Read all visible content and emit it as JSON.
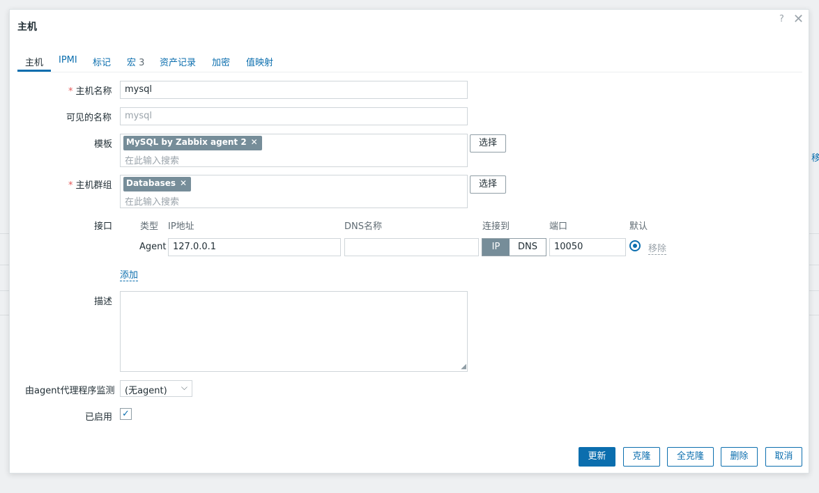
{
  "dialog": {
    "title": "主机",
    "help": "?",
    "close": "✕"
  },
  "tabs": [
    {
      "label": "主机"
    },
    {
      "label": "IPMI"
    },
    {
      "label": "标记"
    },
    {
      "label": "宏",
      "count": "3"
    },
    {
      "label": "资产记录"
    },
    {
      "label": "加密"
    },
    {
      "label": "值映射"
    }
  ],
  "form": {
    "host_name": {
      "label": "主机名称",
      "value": "mysql",
      "required_mark": "*"
    },
    "visible_name": {
      "label": "可见的名称",
      "placeholder": "mysql"
    },
    "templates": {
      "label": "模板",
      "chip": "MySQL by Zabbix agent 2",
      "placeholder": "在此输入搜索",
      "select_button": "选择"
    },
    "host_groups": {
      "label": "主机群组",
      "chip": "Databases",
      "placeholder": "在此输入搜索",
      "select_button": "选择",
      "required_mark": "*"
    },
    "interfaces": {
      "label": "接口",
      "columns": {
        "type": "类型",
        "ip": "IP地址",
        "dns": "DNS名称",
        "connect": "连接到",
        "port": "端口",
        "default": "默认"
      },
      "row": {
        "type": "Agent",
        "ip": "127.0.0.1",
        "dns": "",
        "connect_ip": "IP",
        "connect_dns": "DNS",
        "port": "10050",
        "remove": "移除"
      },
      "add": "添加"
    },
    "description": {
      "label": "描述",
      "value": ""
    },
    "monitored_by": {
      "label": "由agent代理程序监测",
      "selected": "(无agent)"
    },
    "enabled": {
      "label": "已启用",
      "checked": true
    }
  },
  "footer": {
    "update": "更新",
    "clone": "克隆",
    "full_clone": "全克隆",
    "delete": "删除",
    "cancel": "取消"
  },
  "background": {
    "fragment": "移"
  }
}
